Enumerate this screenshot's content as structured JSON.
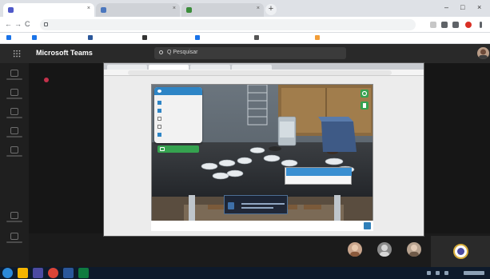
{
  "browser": {
    "tabs": [
      {
        "title": "",
        "favicon_color": "#5059c9",
        "active": true
      },
      {
        "title": "",
        "favicon_color": "#4b77be",
        "active": false
      },
      {
        "title": "",
        "favicon_color": "#3a8c3a",
        "active": false
      }
    ],
    "close_glyph": "×",
    "new_tab_glyph": "+",
    "window_controls": [
      "–",
      "□",
      "×"
    ],
    "nav": {
      "back": "←",
      "forward": "→",
      "reload": "C"
    },
    "url": "",
    "bookmarks": [
      {
        "label": "",
        "color": "#1a73e8"
      },
      {
        "label": "",
        "color": "#1a73e8"
      },
      {
        "label": "",
        "color": "#2b579a"
      },
      {
        "label": "",
        "color": "#333333"
      },
      {
        "label": "",
        "color": "#1a73e8"
      },
      {
        "label": "",
        "color": "#555555"
      },
      {
        "label": "",
        "color": "#f29d38"
      }
    ],
    "reading_list": ""
  },
  "teams": {
    "app_title": "Microsoft Teams",
    "search_placeholder": "Q Pesquisar",
    "rail_count": 7,
    "accent": "#464775"
  },
  "shared": {
    "toolbar_label": "",
    "menu_items": [
      {
        "label": "",
        "checked": true
      },
      {
        "label": "",
        "checked": true
      },
      {
        "label": "",
        "checked": false
      },
      {
        "label": "",
        "checked": false
      },
      {
        "label": "",
        "checked": true
      }
    ],
    "objects_button": "",
    "context_menu": [
      "",
      ""
    ],
    "info_title": "",
    "bottom_text": "",
    "logo": ""
  },
  "participants": [
    {
      "color": "#c9a58c"
    },
    {
      "color": "#8a8a8a"
    },
    {
      "color": "#b8a390"
    }
  ]
}
